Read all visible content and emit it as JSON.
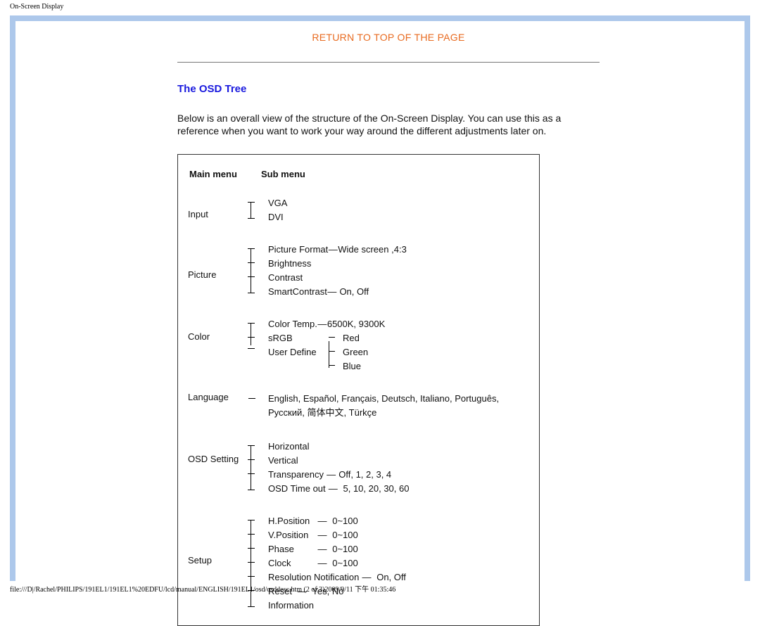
{
  "header_small": "On-Screen Display",
  "return_link": "RETURN TO TOP OF THE PAGE",
  "section_heading": "The OSD Tree",
  "intro_text": "Below is an overall view of the structure of the On-Screen Display. You can use this as a reference when you want to work your way around the different adjustments later on.",
  "columns": {
    "main": "Main menu",
    "sub": "Sub menu"
  },
  "tree": {
    "input": {
      "label": "Input",
      "items": [
        "VGA",
        "DVI"
      ]
    },
    "picture": {
      "label": "Picture",
      "items": [
        {
          "name": "Picture Format",
          "vals": "Wide screen ,4:3"
        },
        {
          "name": "Brightness",
          "vals": ""
        },
        {
          "name": "Contrast",
          "vals": ""
        },
        {
          "name": "SmartContrast",
          "vals": "On, Off"
        }
      ]
    },
    "color": {
      "label": "Color",
      "items": [
        {
          "name": "Color Temp.",
          "vals": "6500K, 9300K"
        },
        {
          "name": "sRGB",
          "vals": ""
        },
        {
          "name": "User Define",
          "children": [
            "Red",
            "Green",
            "Blue"
          ]
        }
      ]
    },
    "language": {
      "label": "Language",
      "text": "English, Español, Français, Deutsch, Italiano, Português, Русский,  简体中文, Türkçe"
    },
    "osd": {
      "label": "OSD Setting",
      "items": [
        {
          "name": "Horizontal",
          "vals": ""
        },
        {
          "name": "Vertical",
          "vals": ""
        },
        {
          "name": "Transparency",
          "vals": "Off, 1, 2, 3, 4"
        },
        {
          "name": "OSD Time out",
          "vals": "5, 10, 20, 30, 60"
        }
      ]
    },
    "setup": {
      "label": "Setup",
      "items": [
        {
          "name": "H.Position",
          "vals": "0~100"
        },
        {
          "name": "V.Position",
          "vals": "0~100"
        },
        {
          "name": "Phase",
          "vals": "0~100"
        },
        {
          "name": "Clock",
          "vals": "0~100"
        },
        {
          "name": "Resolution Notification",
          "vals": "On, Off"
        },
        {
          "name": "Reset",
          "vals": "Yes, No"
        },
        {
          "name": "Information",
          "vals": ""
        }
      ]
    }
  },
  "footer_path": "file:///D|/Rachel/PHILIPS/191EL1/191EL1%20EDFU/lcd/manual/ENGLISH/191EL1/osd/osddesc.htm (2 of 3)2009/9/11 下午 01:35:46"
}
